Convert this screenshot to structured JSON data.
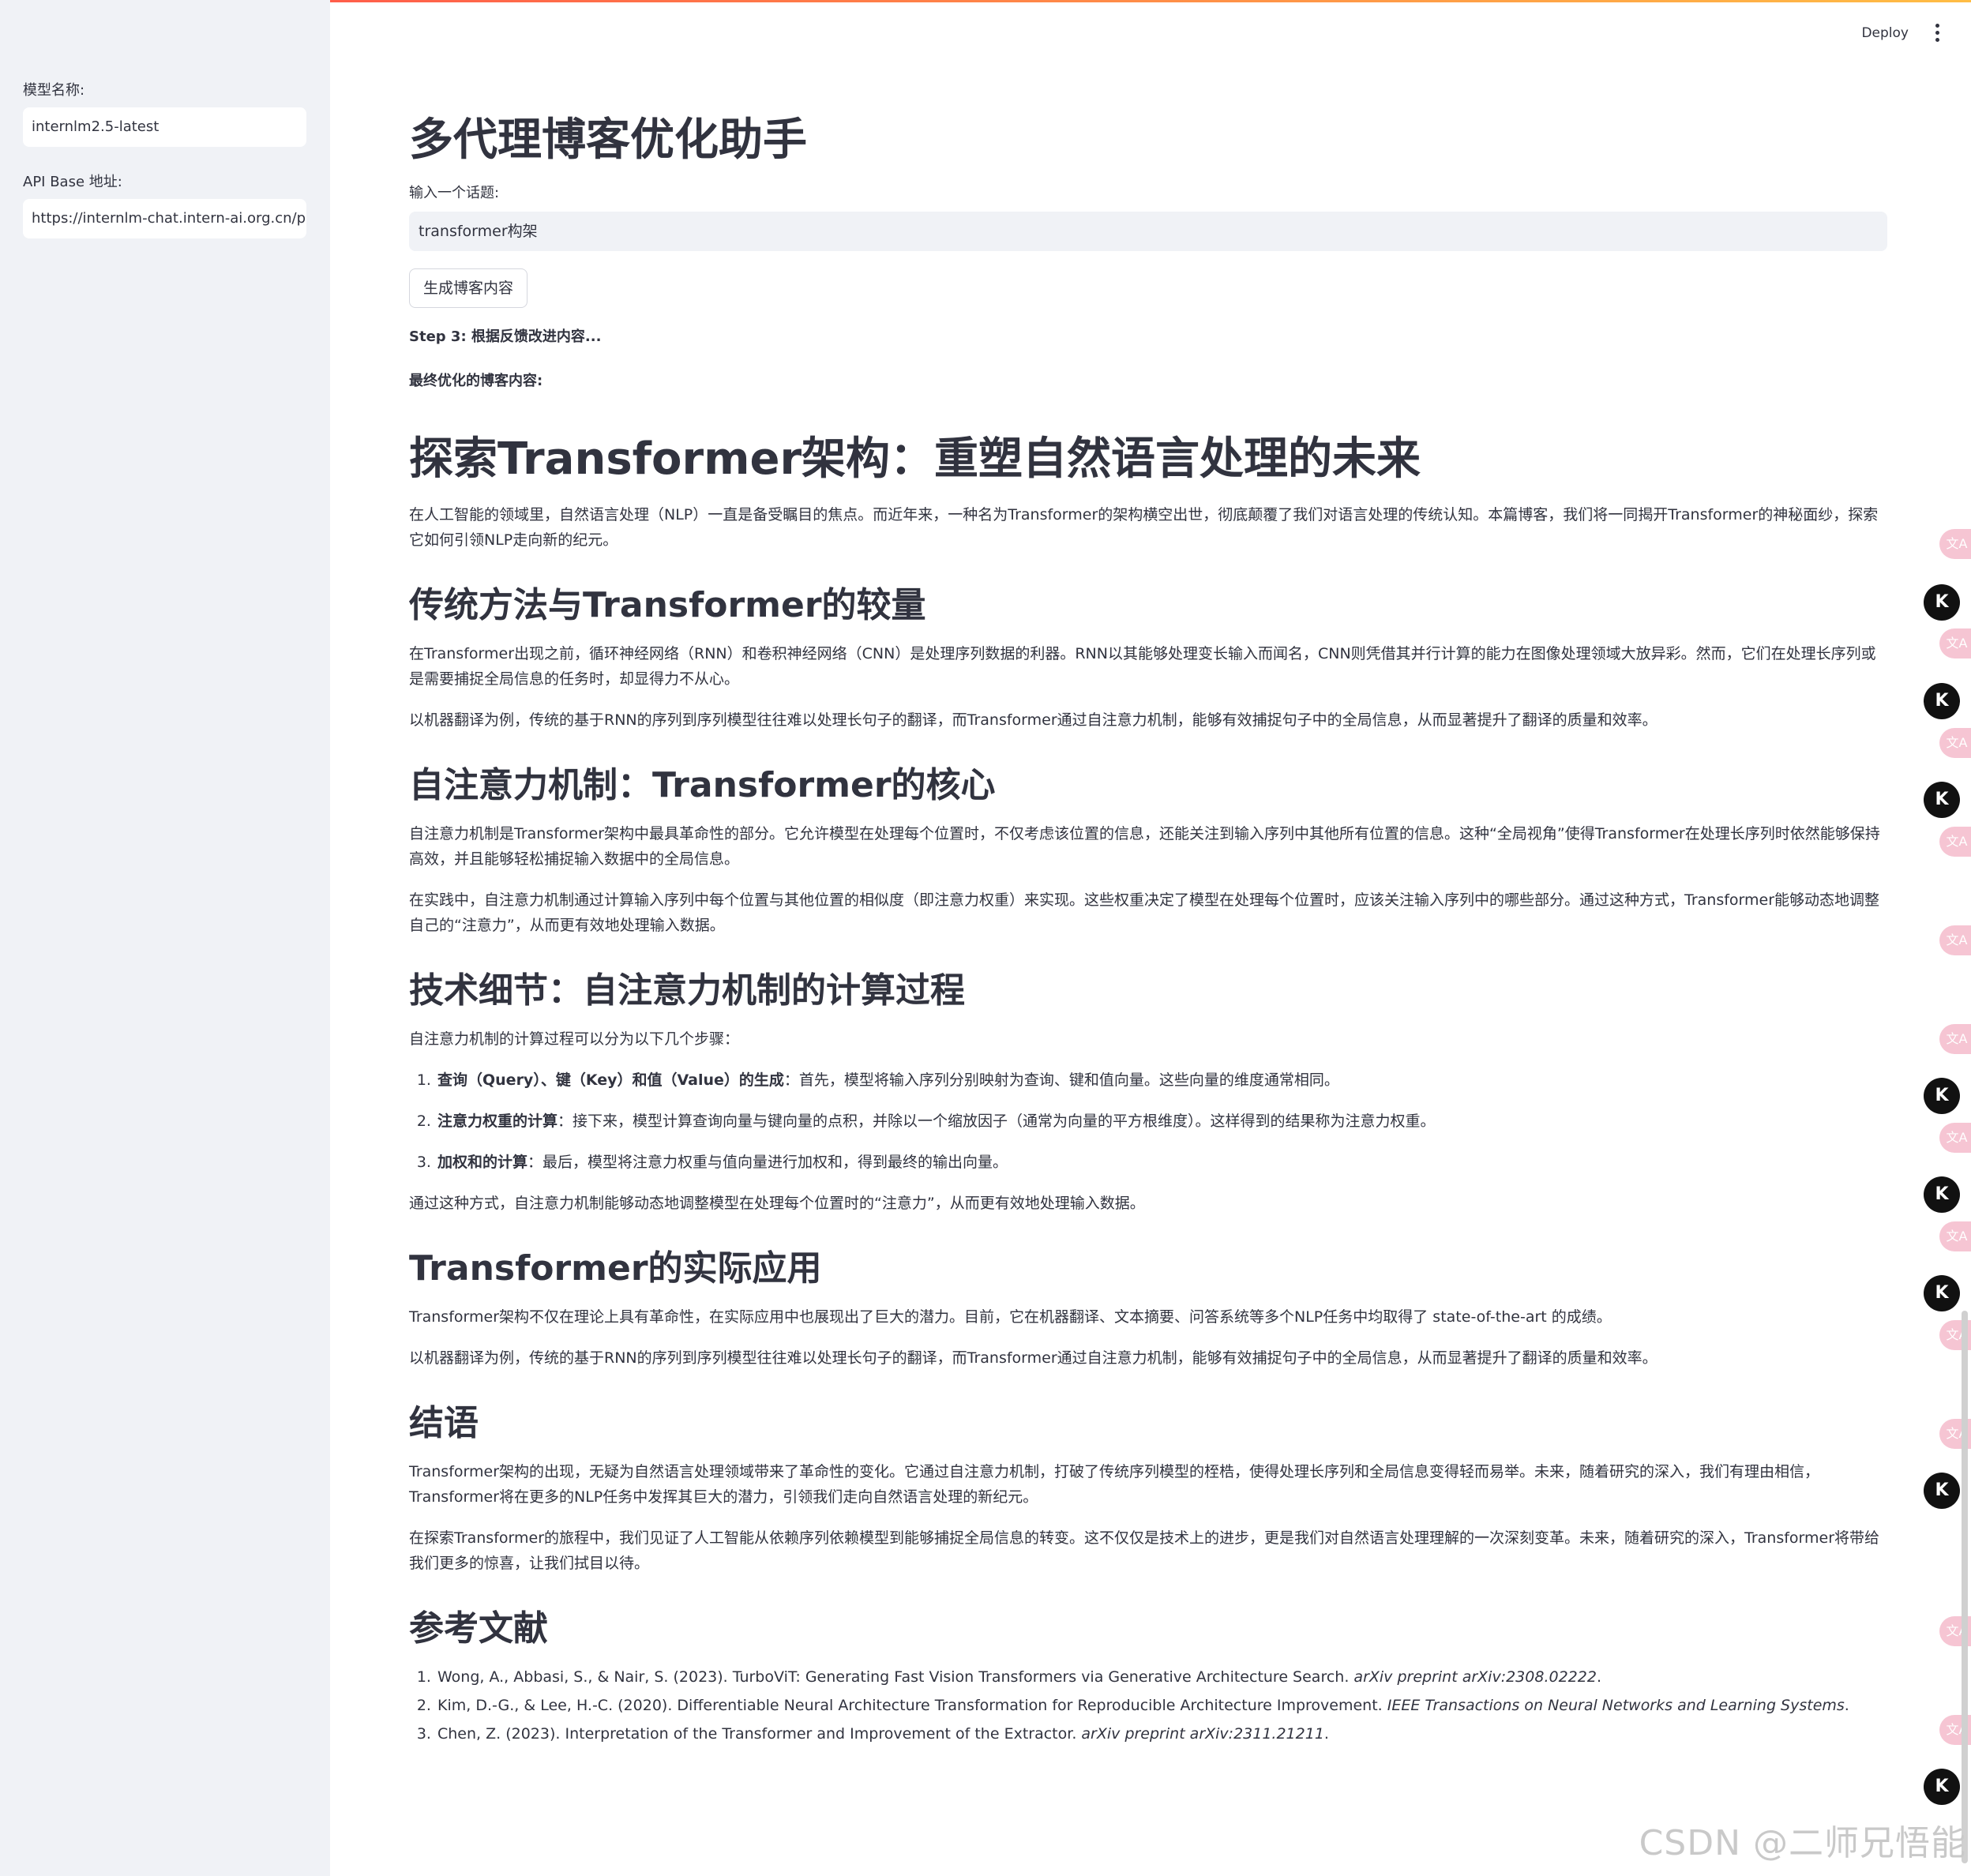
{
  "header": {
    "deploy_label": "Deploy"
  },
  "sidebar": {
    "model_label": "模型名称:",
    "model_value": "internlm2.5-latest",
    "api_label": "API Base 地址:",
    "api_value": "https://internlm-chat.intern-ai.org.cn/pu"
  },
  "main": {
    "title": "多代理博客优化助手",
    "topic_label": "输入一个话题:",
    "topic_value": "transformer构架",
    "generate_button": "生成博客内容",
    "status": "Step 3: 根据反馈改进内容...",
    "final_label": "最终优化的博客内容:"
  },
  "article": {
    "h1": "探索Transformer架构：重塑自然语言处理的未来",
    "intro": "在人工智能的领域里，自然语言处理（NLP）一直是备受瞩目的焦点。而近年来，一种名为Transformer的架构横空出世，彻底颠覆了我们对语言处理的传统认知。本篇博客，我们将一同揭开Transformer的神秘面纱，探索它如何引领NLP走向新的纪元。",
    "s1_title": "传统方法与Transformer的较量",
    "s1_p1": "在Transformer出现之前，循环神经网络（RNN）和卷积神经网络（CNN）是处理序列数据的利器。RNN以其能够处理变长输入而闻名，CNN则凭借其并行计算的能力在图像处理领域大放异彩。然而，它们在处理长序列或是需要捕捉全局信息的任务时，却显得力不从心。",
    "s1_p2": "以机器翻译为例，传统的基于RNN的序列到序列模型往往难以处理长句子的翻译，而Transformer通过自注意力机制，能够有效捕捉句子中的全局信息，从而显著提升了翻译的质量和效率。",
    "s2_title": "自注意力机制：Transformer的核心",
    "s2_p1": "自注意力机制是Transformer架构中最具革命性的部分。它允许模型在处理每个位置时，不仅考虑该位置的信息，还能关注到输入序列中其他所有位置的信息。这种“全局视角”使得Transformer在处理长序列时依然能够保持高效，并且能够轻松捕捉输入数据中的全局信息。",
    "s2_p2": "在实践中，自注意力机制通过计算输入序列中每个位置与其他位置的相似度（即注意力权重）来实现。这些权重决定了模型在处理每个位置时，应该关注输入序列中的哪些部分。通过这种方式，Transformer能够动态地调整自己的“注意力”，从而更有效地处理输入数据。",
    "s3_title": "技术细节：自注意力机制的计算过程",
    "s3_intro": "自注意力机制的计算过程可以分为以下几个步骤：",
    "s3_steps": [
      {
        "bold": "查询（Query）、键（Key）和值（Value）的生成",
        "text": "：首先，模型将输入序列分别映射为查询、键和值向量。这些向量的维度通常相同。"
      },
      {
        "bold": "注意力权重的计算",
        "text": "：接下来，模型计算查询向量与键向量的点积，并除以一个缩放因子（通常为向量的平方根维度）。这样得到的结果称为注意力权重。"
      },
      {
        "bold": "加权和的计算",
        "text": "：最后，模型将注意力权重与值向量进行加权和，得到最终的输出向量。"
      }
    ],
    "s3_outro": "通过这种方式，自注意力机制能够动态地调整模型在处理每个位置时的“注意力”，从而更有效地处理输入数据。",
    "s4_title": "Transformer的实际应用",
    "s4_p1": "Transformer架构不仅在理论上具有革命性，在实际应用中也展现出了巨大的潜力。目前，它在机器翻译、文本摘要、问答系统等多个NLP任务中均取得了 state-of-the-art 的成绩。",
    "s4_p2": "以机器翻译为例，传统的基于RNN的序列到序列模型往往难以处理长句子的翻译，而Transformer通过自注意力机制，能够有效捕捉句子中的全局信息，从而显著提升了翻译的质量和效率。",
    "s5_title": "结语",
    "s5_p1": "Transformer架构的出现，无疑为自然语言处理领域带来了革命性的变化。它通过自注意力机制，打破了传统序列模型的桎梏，使得处理长序列和全局信息变得轻而易举。未来，随着研究的深入，我们有理由相信，Transformer将在更多的NLP任务中发挥其巨大的潜力，引领我们走向自然语言处理的新纪元。",
    "s5_p2": "在探索Transformer的旅程中，我们见证了人工智能从依赖序列依赖模型到能够捕捉全局信息的转变。这不仅仅是技术上的进步，更是我们对自然语言处理理解的一次深刻变革。未来，随着研究的深入，Transformer将带给我们更多的惊喜，让我们拭目以待。",
    "refs_title": "参考文献",
    "refs": [
      {
        "text": "Wong, A., Abbasi, S., & Nair, S. (2023). TurboViT: Generating Fast Vision Transformers via Generative Architecture Search. ",
        "italic": "arXiv preprint arXiv:2308.02222",
        "end": "."
      },
      {
        "text": "Kim, D.-G., & Lee, H.-C. (2020). Differentiable Neural Architecture Transformation for Reproducible Architecture Improvement. ",
        "italic": "IEEE Transactions on Neural Networks and Learning Systems",
        "end": "."
      },
      {
        "text": "Chen, Z. (2023). Interpretation of the Transformer and Improvement of the Extractor. ",
        "italic": "arXiv preprint arXiv:2311.21211",
        "end": "."
      }
    ]
  },
  "watermark": "CSDN @二师兄悟能",
  "side_icons": {
    "pink_glyph": "文A",
    "black_glyph": "K"
  }
}
